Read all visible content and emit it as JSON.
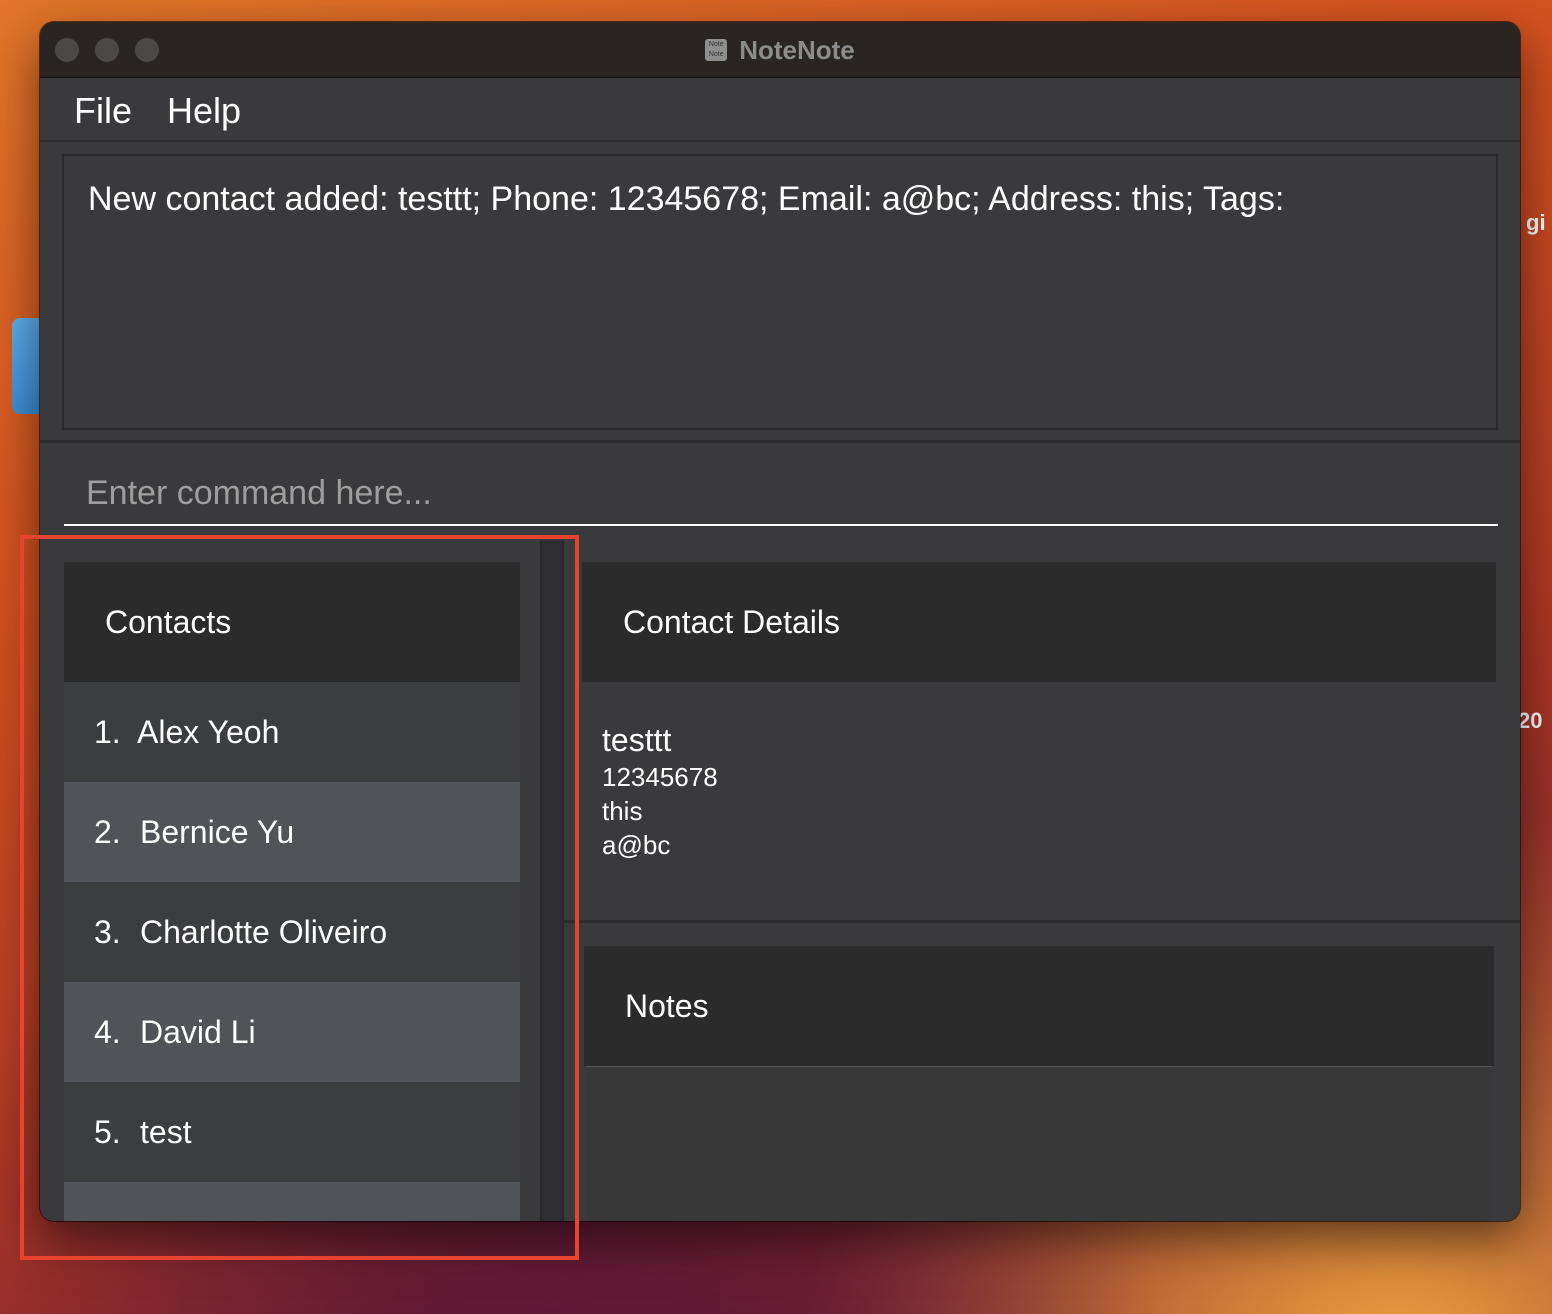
{
  "window": {
    "title": "NoteNote",
    "app_icon_text": "Note Note"
  },
  "menu": {
    "file": "File",
    "help": "Help"
  },
  "result": {
    "text": "New contact added: testtt; Phone: 12345678; Email: a@bc; Address: this; Tags:"
  },
  "command": {
    "placeholder": "Enter command here..."
  },
  "contacts": {
    "header": "Contacts",
    "items": [
      {
        "index": "1.",
        "name": "Alex Yeoh"
      },
      {
        "index": "2.",
        "name": "Bernice Yu"
      },
      {
        "index": "3.",
        "name": "Charlotte Oliveiro"
      },
      {
        "index": "4.",
        "name": "David Li"
      },
      {
        "index": "5.",
        "name": "test"
      },
      {
        "index": "",
        "name": ""
      }
    ]
  },
  "details": {
    "header": "Contact Details",
    "name": "testtt",
    "phone": "12345678",
    "address": "this",
    "email": "a@bc"
  },
  "notes": {
    "header": "Notes"
  },
  "desktop": {
    "label_a": "gi",
    "label_b": "20"
  },
  "colors": {
    "window_bg": "#3a3a3c",
    "panel_header_bg": "#2b2b2b",
    "row_odd": "#3c3d3f",
    "row_even": "#505459",
    "highlight": "#e8432e"
  }
}
